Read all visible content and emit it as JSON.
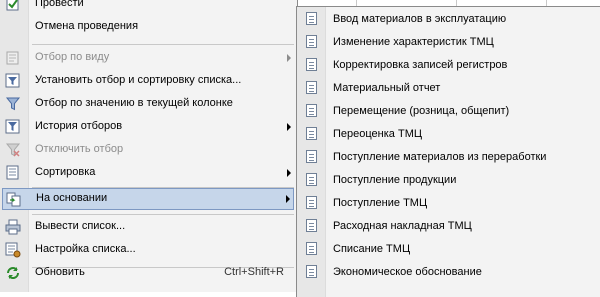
{
  "main_menu": {
    "items": [
      {
        "label": "Провести",
        "icon": "post-icon",
        "disabled": false
      },
      {
        "label": "Отмена проведения",
        "icon": "",
        "disabled": false
      },
      {
        "label": "Отбор по виду",
        "icon": "filter-by-type-icon",
        "disabled": true,
        "submenu": true
      },
      {
        "label": "Установить отбор и сортировку списка...",
        "icon": "filter-sort-icon",
        "disabled": false
      },
      {
        "label": "Отбор по значению в текущей колонке",
        "icon": "filter-column-icon",
        "disabled": false
      },
      {
        "label": "История отборов",
        "icon": "filter-history-icon",
        "disabled": false,
        "submenu": true
      },
      {
        "label": "Отключить отбор",
        "icon": "filter-off-icon",
        "disabled": true
      },
      {
        "label": "Сортировка",
        "icon": "sort-icon",
        "disabled": false,
        "submenu": true
      },
      {
        "label": "На основании",
        "icon": "based-on-icon",
        "disabled": false,
        "submenu": true,
        "highlighted": true
      },
      {
        "label": "Вывести список...",
        "icon": "print-list-icon",
        "disabled": false
      },
      {
        "label": "Настройка списка...",
        "icon": "list-settings-icon",
        "disabled": false
      },
      {
        "label": "Обновить",
        "icon": "refresh-icon",
        "disabled": false,
        "shortcut": "Ctrl+Shift+R"
      }
    ]
  },
  "sub_menu": {
    "items": [
      {
        "label": "Ввод материалов в эксплуатацию"
      },
      {
        "label": "Изменение характеристик ТМЦ"
      },
      {
        "label": "Корректировка записей регистров"
      },
      {
        "label": "Материальный отчет"
      },
      {
        "label": "Перемещение (розница, общепит)"
      },
      {
        "label": "Переоценка ТМЦ"
      },
      {
        "label": "Поступление материалов из переработки"
      },
      {
        "label": "Поступление продукции"
      },
      {
        "label": "Поступление ТМЦ"
      },
      {
        "label": "Расходная накладная ТМЦ"
      },
      {
        "label": "Списание ТМЦ"
      },
      {
        "label": "Экономическое обоснование"
      }
    ]
  },
  "colors": {
    "menu_bg": "#f3f3f3",
    "highlight_bg": "#c6d6ea",
    "highlight_border": "#7d98c2",
    "disabled_text": "#8c8c8c"
  }
}
